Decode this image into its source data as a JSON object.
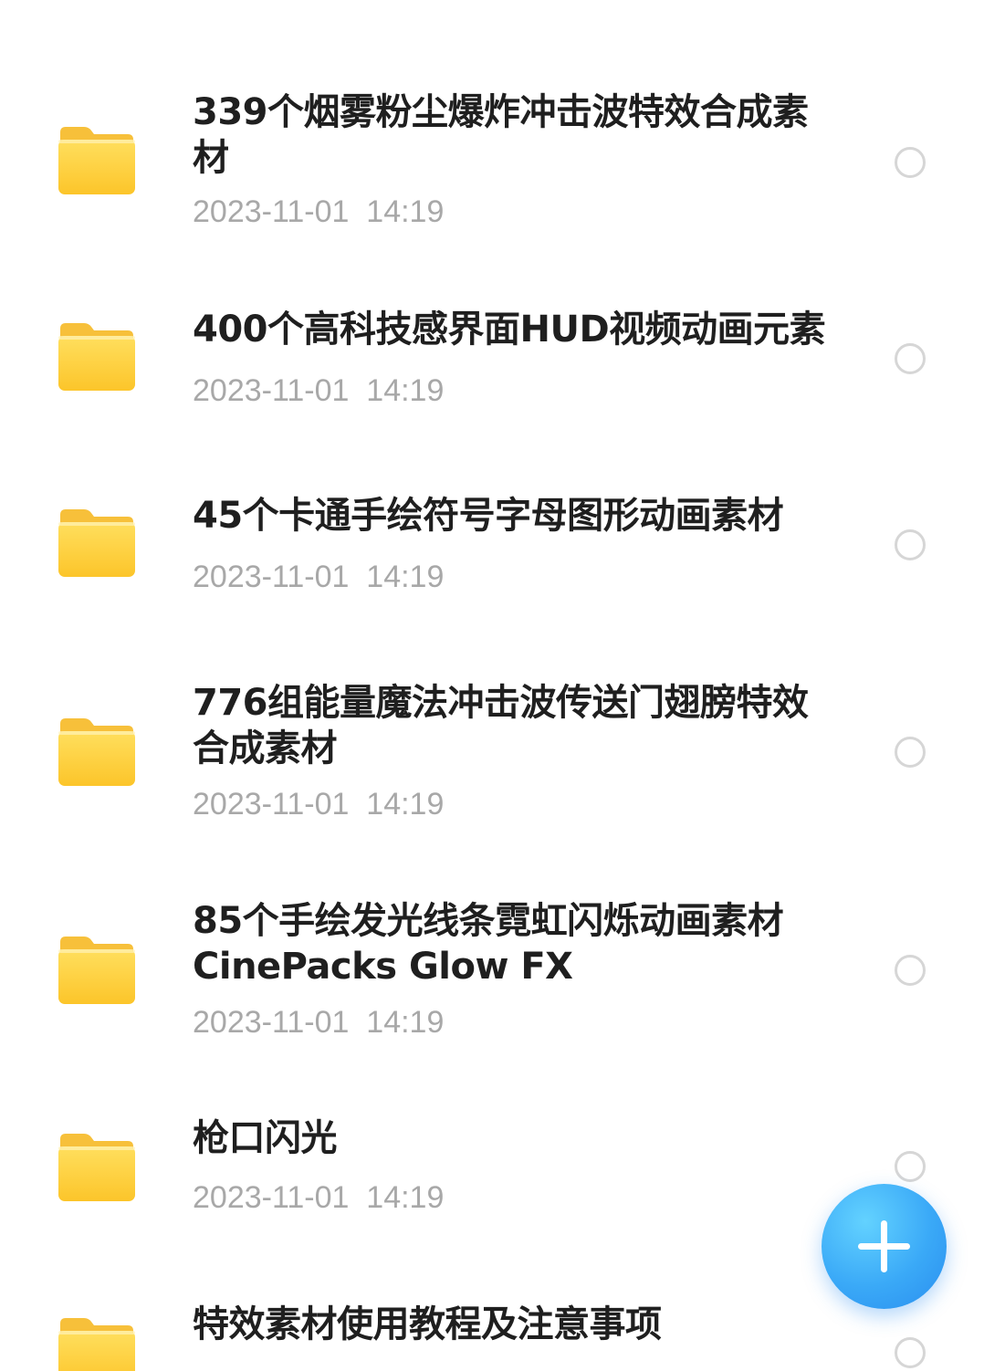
{
  "files": [
    {
      "name": "339个烟雾粉尘爆炸冲击波特效合成素材",
      "date": "2023-11-01  14:19",
      "icon": "folder-icon",
      "selected": false
    },
    {
      "name": "400个高科技感界面HUD视频动画元素",
      "date": "2023-11-01  14:19",
      "icon": "folder-icon",
      "selected": false
    },
    {
      "name": "45个卡通手绘符号字母图形动画素材",
      "date": "2023-11-01  14:19",
      "icon": "folder-icon",
      "selected": false
    },
    {
      "name": "776组能量魔法冲击波传送门翅膀特效合成素材",
      "date": "2023-11-01  14:19",
      "icon": "folder-icon",
      "selected": false
    },
    {
      "name": "85个手绘发光线条霓虹闪烁动画素材 CinePacks Glow FX",
      "date": "2023-11-01  14:19",
      "icon": "folder-icon",
      "selected": false
    },
    {
      "name": "枪口闪光",
      "date": "2023-11-01  14:19",
      "icon": "folder-icon",
      "selected": false
    },
    {
      "name": "特效素材使用教程及注意事项",
      "date": "",
      "icon": "folder-icon",
      "selected": false
    }
  ],
  "fab": {
    "icon": "plus-icon",
    "color": "#3aa9f7"
  },
  "colors": {
    "folder": "#ffd23f",
    "title_text": "#1f1f1f",
    "date_text": "#a8a8a8",
    "radio_border": "#d6d6d6"
  }
}
